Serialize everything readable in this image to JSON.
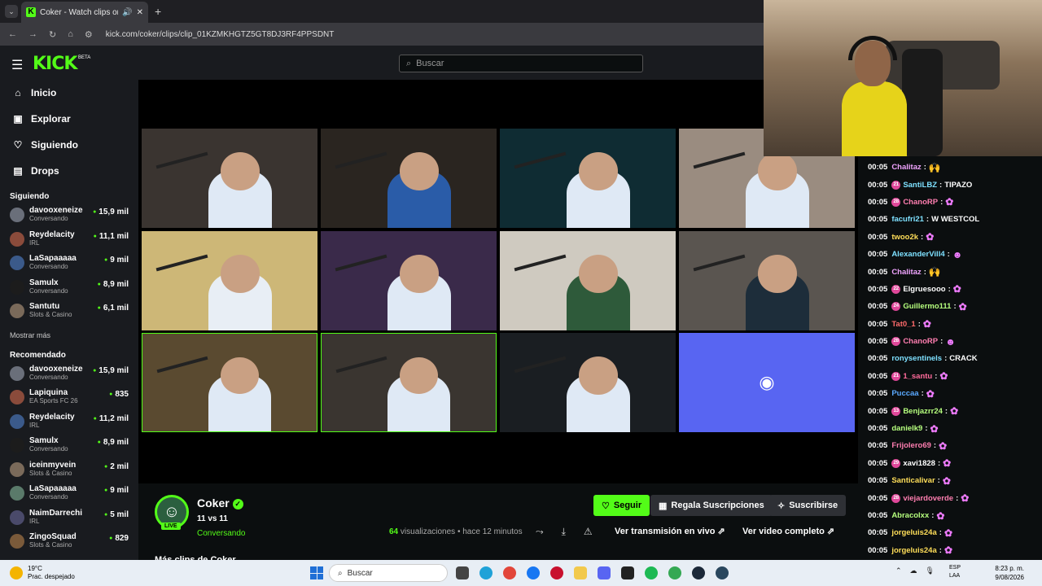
{
  "browser": {
    "tab_title": "Coker - Watch clips on Kick",
    "url": "kick.com/coker/clips/clip_01KZMKHGTZ5GT8DJ3RF4PPSDNT"
  },
  "header": {
    "logo": "KICK",
    "beta": "BETA",
    "search_placeholder": "Buscar"
  },
  "sidebar": {
    "nav": [
      {
        "label": "Inicio",
        "icon": "home-icon",
        "glyph": "⌂"
      },
      {
        "label": "Explorar",
        "icon": "compass-icon",
        "glyph": "▣"
      },
      {
        "label": "Siguiendo",
        "icon": "heart-icon",
        "glyph": "♡"
      },
      {
        "label": "Drops",
        "icon": "drops-icon",
        "glyph": "▤"
      }
    ],
    "following_title": "Siguiendo",
    "following": [
      {
        "name": "davooxeneize",
        "sub": "Conversando",
        "viewers": "15,9 mil"
      },
      {
        "name": "Reydelacity",
        "sub": "IRL",
        "viewers": "11,1 mil"
      },
      {
        "name": "LaSapaaaaa",
        "sub": "Conversando",
        "viewers": "9 mil"
      },
      {
        "name": "Samulx",
        "sub": "Conversando",
        "viewers": "8,9 mil"
      },
      {
        "name": "Santutu",
        "sub": "Slots & Casino",
        "viewers": "6,1 mil"
      }
    ],
    "show_more": "Mostrar más",
    "recommended_title": "Recomendado",
    "recommended": [
      {
        "name": "davooxeneize",
        "sub": "Conversando",
        "viewers": "15,9 mil"
      },
      {
        "name": "Lapiquina",
        "sub": "EA Sports FC 26",
        "viewers": "835"
      },
      {
        "name": "Reydelacity",
        "sub": "IRL",
        "viewers": "11,2 mil"
      },
      {
        "name": "Samulx",
        "sub": "Conversando",
        "viewers": "8,9 mil"
      },
      {
        "name": "iceinmyvein",
        "sub": "Slots & Casino",
        "viewers": "2 mil"
      },
      {
        "name": "LaSapaaaaa",
        "sub": "Conversando",
        "viewers": "9 mil"
      },
      {
        "name": "NaimDarrechi",
        "sub": "IRL",
        "viewers": "5 mil"
      },
      {
        "name": "ZingoSquad",
        "sub": "Slots & Casino",
        "viewers": "829"
      }
    ]
  },
  "channel": {
    "name": "Coker",
    "live": "LIVE",
    "title": "11 vs 11",
    "category": "Conversando",
    "follow": "Seguir",
    "gift": "Regala Suscripciones",
    "subscribe": "Suscribirse",
    "views_count": "64",
    "views_label": "visualizaciones",
    "time": "• hace 12 minutos",
    "watch_live": "Ver transmisión en vivo",
    "watch_full": "Ver video completo",
    "more_clips": "Más clips de Coker"
  },
  "chat": [
    {
      "time": "00:05",
      "user": "Chalitaz",
      "color": "#f0a4ff",
      "text": "",
      "emote": "🙌"
    },
    {
      "time": "00:05",
      "user": "SantiLBZ",
      "color": "#7ee0ff",
      "text": "TIPAZO",
      "badge": "21"
    },
    {
      "time": "00:05",
      "user": "ChanoRP",
      "color": "#ff7eb0",
      "text": "",
      "badge": "28",
      "emote": "✿"
    },
    {
      "time": "00:05",
      "user": "facufri21",
      "color": "#7ee0ff",
      "text": "W WESTCOL"
    },
    {
      "time": "00:05",
      "user": "twoo2k",
      "color": "#ffde59",
      "text": "",
      "emote": "✿"
    },
    {
      "time": "00:05",
      "user": "AlexanderVill4",
      "color": "#7ee0ff",
      "text": "",
      "emote": "☻"
    },
    {
      "time": "00:05",
      "user": "Chalitaz",
      "color": "#f0a4ff",
      "text": "",
      "emote": "🙌"
    },
    {
      "time": "00:05",
      "user": "Elgruesooo",
      "color": "#ffffff",
      "text": "",
      "badge": "22",
      "emote": "✿"
    },
    {
      "time": "00:05",
      "user": "Guillermo111",
      "color": "#b6ff7e",
      "text": "",
      "badge": "24",
      "emote": "✿"
    },
    {
      "time": "00:05",
      "user": "Tat0_1",
      "color": "#ff6b6b",
      "text": "",
      "emote": "✿"
    },
    {
      "time": "00:05",
      "user": "ChanoRP",
      "color": "#ff7eb0",
      "text": "",
      "badge": "28",
      "emote": "☻"
    },
    {
      "time": "00:05",
      "user": "ronysentinels",
      "color": "#7ee0ff",
      "text": "CRACK"
    },
    {
      "time": "00:05",
      "user": "1_santu",
      "color": "#ff6b9b",
      "text": "",
      "badge": "21",
      "emote": "✿"
    },
    {
      "time": "00:05",
      "user": "Puccaa",
      "color": "#5aa9ff",
      "text": "",
      "emote": "✿"
    },
    {
      "time": "00:05",
      "user": "Benjazrr24",
      "color": "#b6ff7e",
      "text": "",
      "badge": "13",
      "emote": "✿"
    },
    {
      "time": "00:05",
      "user": "danielk9",
      "color": "#b6ff7e",
      "text": "",
      "emote": "✿"
    },
    {
      "time": "00:05",
      "user": "Frijolero69",
      "color": "#ff7eb0",
      "text": "",
      "emote": "✿"
    },
    {
      "time": "00:05",
      "user": "xavi1828",
      "color": "#ffffff",
      "text": "",
      "badge": "29",
      "emote": "✿"
    },
    {
      "time": "00:05",
      "user": "Santicalivar",
      "color": "#ffde59",
      "text": "",
      "emote": "✿"
    },
    {
      "time": "00:05",
      "user": "viejardoverde",
      "color": "#ff7eb0",
      "text": "",
      "badge": "28",
      "emote": "✿"
    },
    {
      "time": "00:05",
      "user": "Abracolxx",
      "color": "#b6ff7e",
      "text": "",
      "emote": "✿"
    },
    {
      "time": "00:05",
      "user": "jorgeluis24a",
      "color": "#ffde59",
      "text": "",
      "emote": "✿"
    },
    {
      "time": "00:05",
      "user": "jorgeluis24a",
      "color": "#ffde59",
      "text": "",
      "emote": "✿"
    }
  ],
  "taskbar": {
    "temp": "19°C",
    "weather": "Prac. despejado",
    "search": "Buscar",
    "lang1": "ESP",
    "lang2": "LAA",
    "time": "8:23 p. m.",
    "date": "9/08/2026"
  },
  "colors": {
    "accent": "#53fc18",
    "discord": "#5865f2"
  }
}
